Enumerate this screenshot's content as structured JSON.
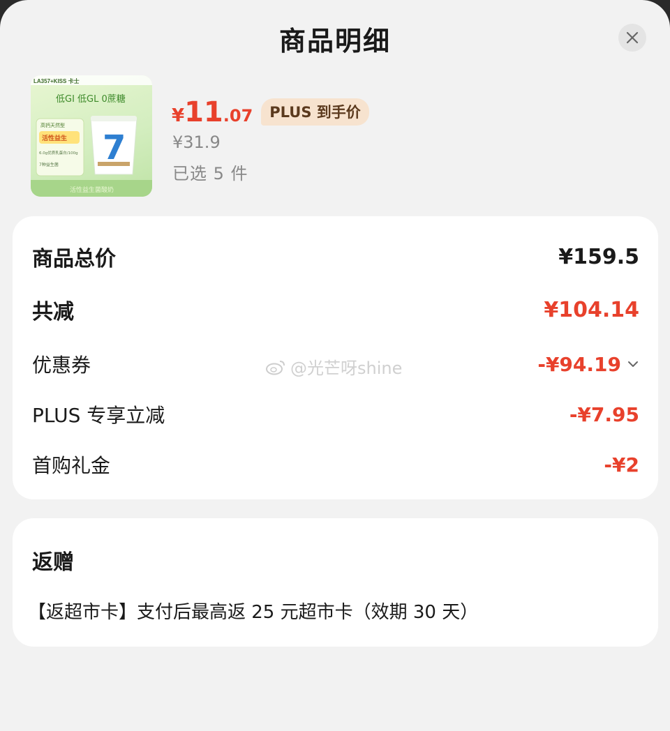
{
  "header": {
    "title": "商品明细"
  },
  "product": {
    "image_text": {
      "brand": "LA357+KISS 卡士",
      "slogan": "低GI 低GL 0蔗糖",
      "badge_top": "高钙天然型",
      "badge_mid": "活性益生",
      "line1": "6.0g优质乳蛋白/100g",
      "line2": "7种益生菌",
      "footer": "活性益生菌酸奶",
      "cup_number": "7"
    },
    "price_symbol": "¥",
    "price_integer": "11",
    "price_decimal": ".07",
    "plus_tag": "PLUS 到手价",
    "original_price": "¥31.9",
    "selected_count": "已选 5 件"
  },
  "summary": {
    "rows": [
      {
        "label": "商品总价",
        "value": "¥159.5"
      },
      {
        "label": "共减",
        "value": "¥104.14"
      },
      {
        "label": "优惠券",
        "value": "-¥94.19"
      },
      {
        "label": "PLUS 专享立减",
        "value": "-¥7.95"
      },
      {
        "label": "首购礼金",
        "value": "-¥2"
      }
    ]
  },
  "gift": {
    "title": "返赠",
    "text": "【返超市卡】支付后最高返 25 元超市卡（效期 30 天）"
  },
  "watermark": "@光芒呀shine",
  "colors": {
    "accent_red": "#e8412c",
    "plus_tag_bg": "#f7e3cf",
    "background": "#f2f2f2",
    "card": "#ffffff"
  },
  "icons": {
    "close": "close-icon",
    "dropdown": "chevron-down-icon"
  }
}
